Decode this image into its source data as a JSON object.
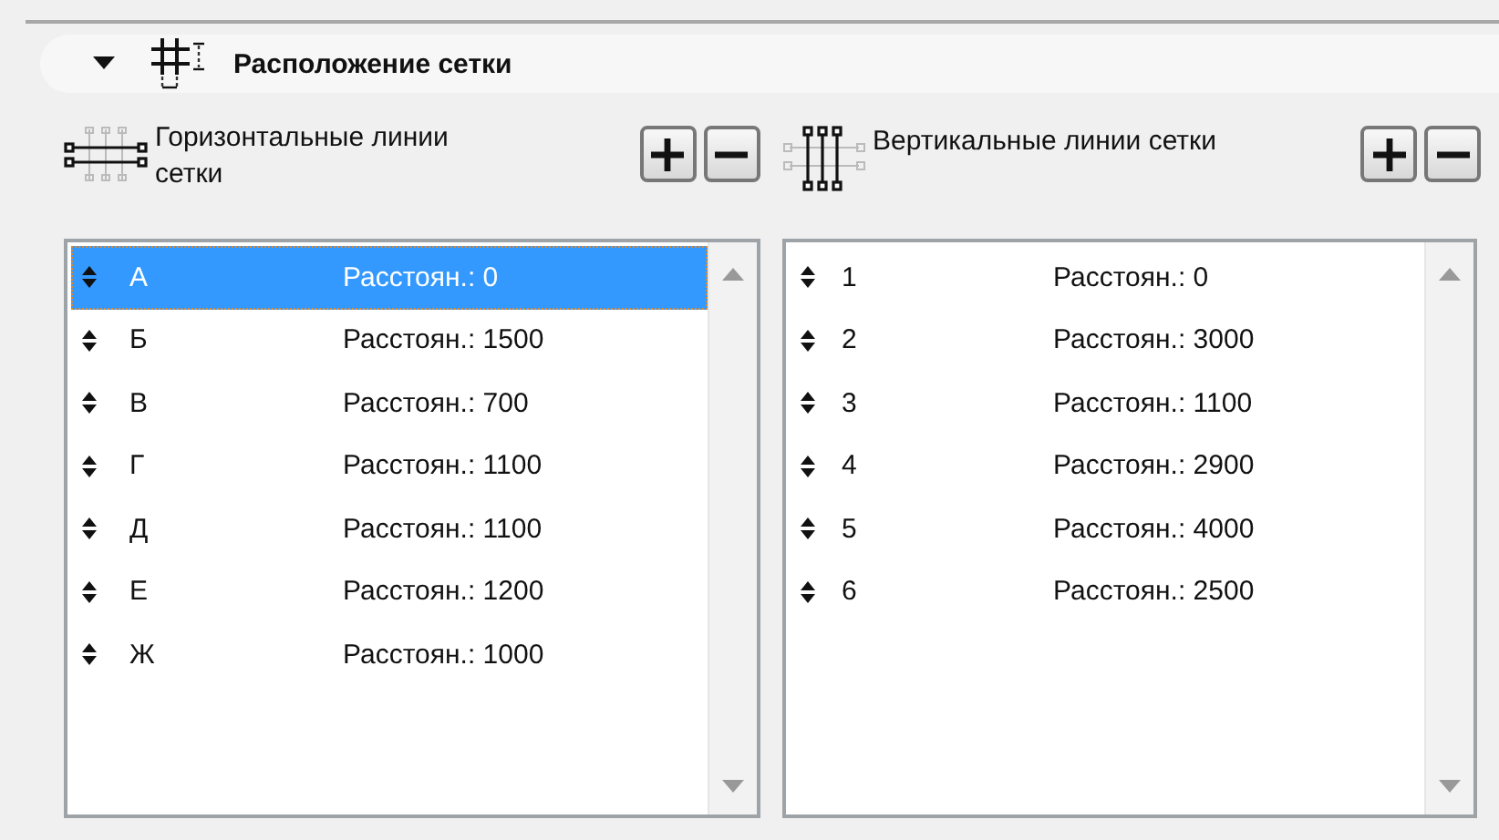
{
  "section": {
    "title": "Расположение сетки",
    "expanded": true
  },
  "panels": [
    {
      "kind": "horizontal",
      "label": "Горизонтальные линии сетки",
      "rows": [
        {
          "name": "А",
          "distance": "Расстоян.: 0",
          "selected": true
        },
        {
          "name": "Б",
          "distance": "Расстоян.: 1500",
          "selected": false
        },
        {
          "name": "В",
          "distance": "Расстоян.: 700",
          "selected": false
        },
        {
          "name": "Г",
          "distance": "Расстоян.: 1100",
          "selected": false
        },
        {
          "name": "Д",
          "distance": "Расстоян.: 1100",
          "selected": false
        },
        {
          "name": "Е",
          "distance": "Расстоян.: 1200",
          "selected": false
        },
        {
          "name": "Ж",
          "distance": "Расстоян.: 1000",
          "selected": false
        }
      ]
    },
    {
      "kind": "vertical",
      "label": "Вертикальные линии сетки",
      "rows": [
        {
          "name": "1",
          "distance": "Расстоян.: 0",
          "selected": false
        },
        {
          "name": "2",
          "distance": "Расстоян.: 3000",
          "selected": false
        },
        {
          "name": "3",
          "distance": "Расстоян.: 1100",
          "selected": false
        },
        {
          "name": "4",
          "distance": "Расстоян.: 2900",
          "selected": false
        },
        {
          "name": "5",
          "distance": "Расстоян.: 4000",
          "selected": false
        },
        {
          "name": "6",
          "distance": "Расстоян.: 2500",
          "selected": false
        }
      ]
    }
  ]
}
